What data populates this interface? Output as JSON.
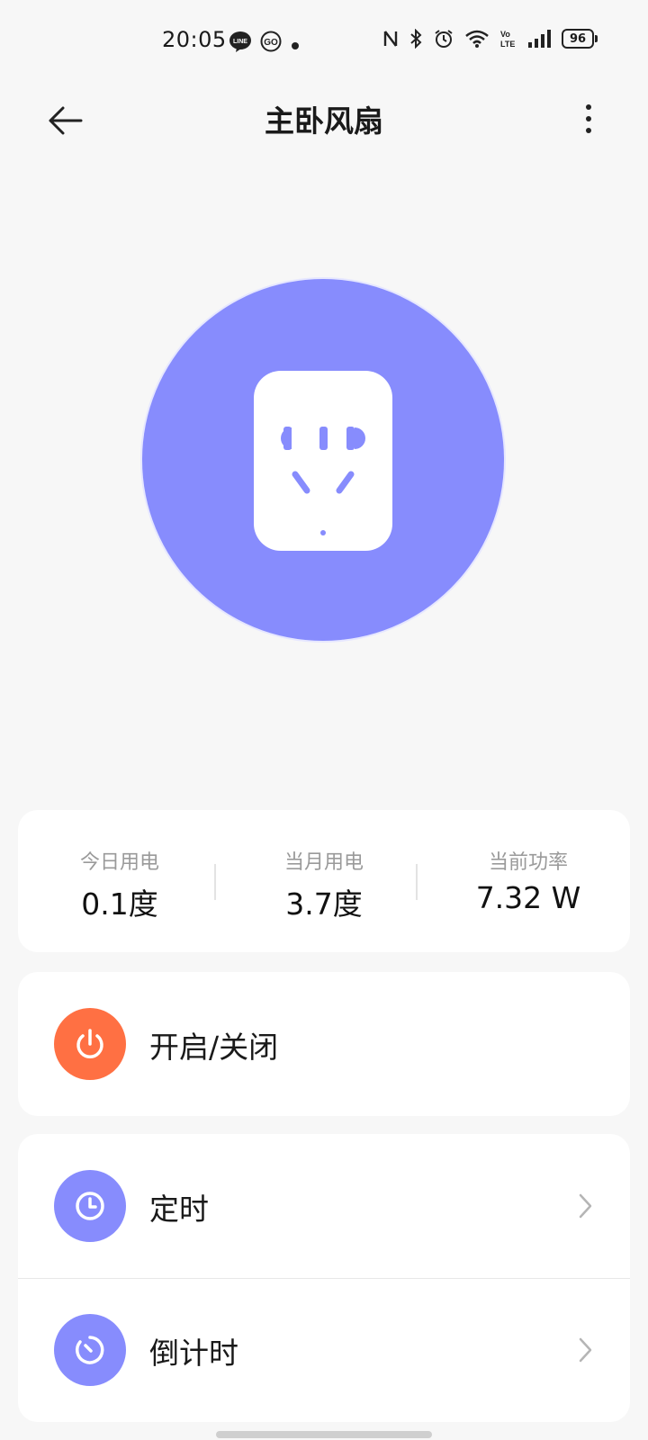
{
  "status_bar": {
    "time": "20:05",
    "battery": "96",
    "icons": [
      "line-icon",
      "go-icon",
      "notification-dot-icon",
      "nfc-icon",
      "bluetooth-icon",
      "alarm-icon",
      "wifi-icon",
      "volte-icon",
      "signal-icon",
      "battery-icon"
    ]
  },
  "header": {
    "title": "主卧风扇",
    "back_icon": "arrow-left-icon",
    "more_icon": "more-vertical-icon"
  },
  "device": {
    "icon": "power-socket-icon",
    "accent_color": "#878cfd"
  },
  "stats": [
    {
      "label": "今日用电",
      "value": "0.1度"
    },
    {
      "label": "当月用电",
      "value": "3.7度"
    },
    {
      "label": "当前功率",
      "value": "7.32 W"
    }
  ],
  "power": {
    "label": "开启/关闭",
    "icon": "power-icon",
    "color": "#ff7043"
  },
  "timers": [
    {
      "label": "定时",
      "icon": "clock-icon"
    },
    {
      "label": "倒计时",
      "icon": "countdown-icon"
    }
  ]
}
